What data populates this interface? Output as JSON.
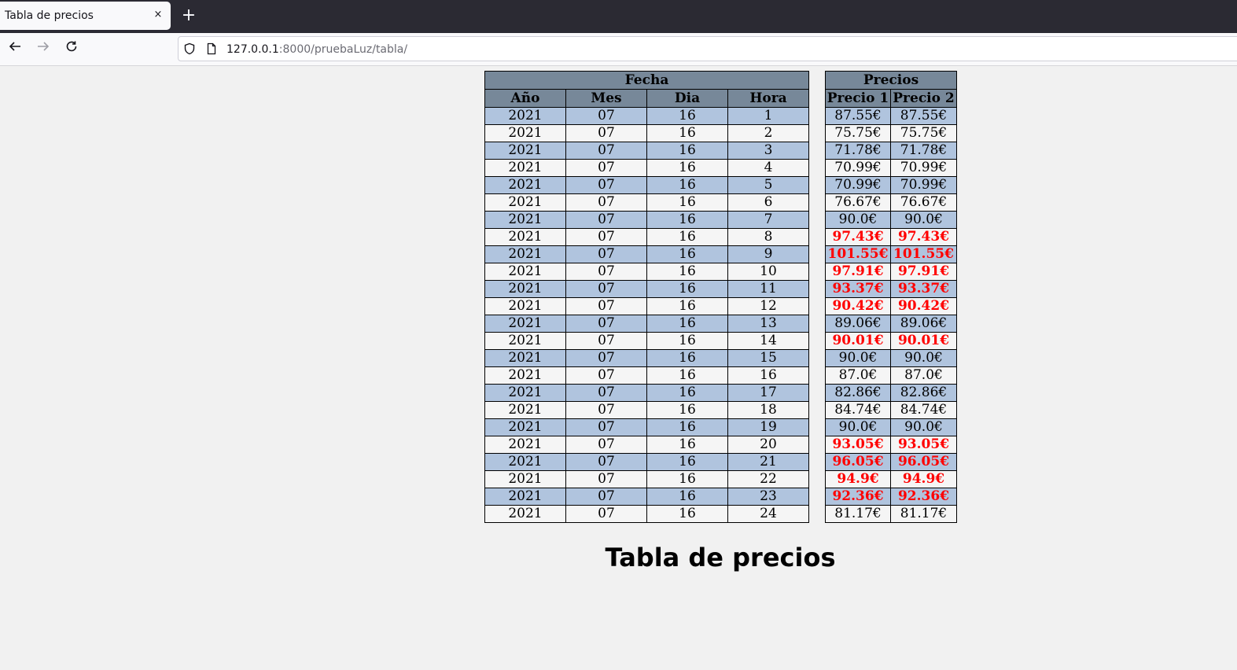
{
  "browser": {
    "tab_title": "Tabla de precios",
    "tab_close": "×",
    "new_tab": "+",
    "url_host": "127.0.0.1",
    "url_rest": ":8000/pruebaLuz/tabla/"
  },
  "fecha_table": {
    "group_header": "Fecha",
    "columns": [
      "Año",
      "Mes",
      "Dia",
      "Hora"
    ]
  },
  "precios_table": {
    "group_header": "Precios",
    "columns": [
      "Precio 1",
      "Precio 2"
    ]
  },
  "rows": [
    {
      "anio": "2021",
      "mes": "07",
      "dia": "16",
      "hora": "1",
      "precio1": "87.55€",
      "precio2": "87.55€",
      "high": false
    },
    {
      "anio": "2021",
      "mes": "07",
      "dia": "16",
      "hora": "2",
      "precio1": "75.75€",
      "precio2": "75.75€",
      "high": false
    },
    {
      "anio": "2021",
      "mes": "07",
      "dia": "16",
      "hora": "3",
      "precio1": "71.78€",
      "precio2": "71.78€",
      "high": false
    },
    {
      "anio": "2021",
      "mes": "07",
      "dia": "16",
      "hora": "4",
      "precio1": "70.99€",
      "precio2": "70.99€",
      "high": false
    },
    {
      "anio": "2021",
      "mes": "07",
      "dia": "16",
      "hora": "5",
      "precio1": "70.99€",
      "precio2": "70.99€",
      "high": false
    },
    {
      "anio": "2021",
      "mes": "07",
      "dia": "16",
      "hora": "6",
      "precio1": "76.67€",
      "precio2": "76.67€",
      "high": false
    },
    {
      "anio": "2021",
      "mes": "07",
      "dia": "16",
      "hora": "7",
      "precio1": "90.0€",
      "precio2": "90.0€",
      "high": false
    },
    {
      "anio": "2021",
      "mes": "07",
      "dia": "16",
      "hora": "8",
      "precio1": "97.43€",
      "precio2": "97.43€",
      "high": true
    },
    {
      "anio": "2021",
      "mes": "07",
      "dia": "16",
      "hora": "9",
      "precio1": "101.55€",
      "precio2": "101.55€",
      "high": true
    },
    {
      "anio": "2021",
      "mes": "07",
      "dia": "16",
      "hora": "10",
      "precio1": "97.91€",
      "precio2": "97.91€",
      "high": true
    },
    {
      "anio": "2021",
      "mes": "07",
      "dia": "16",
      "hora": "11",
      "precio1": "93.37€",
      "precio2": "93.37€",
      "high": true
    },
    {
      "anio": "2021",
      "mes": "07",
      "dia": "16",
      "hora": "12",
      "precio1": "90.42€",
      "precio2": "90.42€",
      "high": true
    },
    {
      "anio": "2021",
      "mes": "07",
      "dia": "16",
      "hora": "13",
      "precio1": "89.06€",
      "precio2": "89.06€",
      "high": false
    },
    {
      "anio": "2021",
      "mes": "07",
      "dia": "16",
      "hora": "14",
      "precio1": "90.01€",
      "precio2": "90.01€",
      "high": true
    },
    {
      "anio": "2021",
      "mes": "07",
      "dia": "16",
      "hora": "15",
      "precio1": "90.0€",
      "precio2": "90.0€",
      "high": false
    },
    {
      "anio": "2021",
      "mes": "07",
      "dia": "16",
      "hora": "16",
      "precio1": "87.0€",
      "precio2": "87.0€",
      "high": false
    },
    {
      "anio": "2021",
      "mes": "07",
      "dia": "16",
      "hora": "17",
      "precio1": "82.86€",
      "precio2": "82.86€",
      "high": false
    },
    {
      "anio": "2021",
      "mes": "07",
      "dia": "16",
      "hora": "18",
      "precio1": "84.74€",
      "precio2": "84.74€",
      "high": false
    },
    {
      "anio": "2021",
      "mes": "07",
      "dia": "16",
      "hora": "19",
      "precio1": "90.0€",
      "precio2": "90.0€",
      "high": false
    },
    {
      "anio": "2021",
      "mes": "07",
      "dia": "16",
      "hora": "20",
      "precio1": "93.05€",
      "precio2": "93.05€",
      "high": true
    },
    {
      "anio": "2021",
      "mes": "07",
      "dia": "16",
      "hora": "21",
      "precio1": "96.05€",
      "precio2": "96.05€",
      "high": true
    },
    {
      "anio": "2021",
      "mes": "07",
      "dia": "16",
      "hora": "22",
      "precio1": "94.9€",
      "precio2": "94.9€",
      "high": true
    },
    {
      "anio": "2021",
      "mes": "07",
      "dia": "16",
      "hora": "23",
      "precio1": "92.36€",
      "precio2": "92.36€",
      "high": true
    },
    {
      "anio": "2021",
      "mes": "07",
      "dia": "16",
      "hora": "24",
      "precio1": "81.17€",
      "precio2": "81.17€",
      "high": false
    }
  ],
  "page_title": "Tabla de precios",
  "colors": {
    "header_bg": "#778899",
    "row_odd_bg": "#b0c4de",
    "row_even_bg": "#f5f5f5",
    "high_price": "#ff0000"
  },
  "icons": {
    "back": "back-arrow-icon",
    "forward": "forward-arrow-icon",
    "reload": "reload-icon",
    "tracking": "shield-icon",
    "page": "page-icon",
    "close": "close-icon",
    "new_tab": "plus-icon"
  }
}
